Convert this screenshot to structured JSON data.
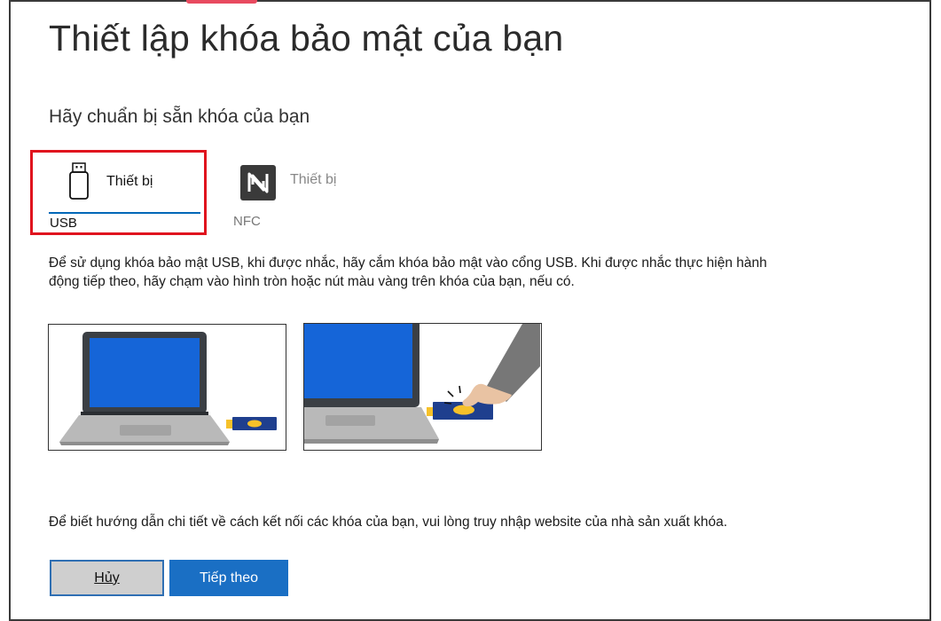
{
  "dialog": {
    "title": "Thiết lập khóa bảo mật của bạn",
    "subtitle": "Hãy chuẩn bị sẵn khóa của bạn"
  },
  "tabs": [
    {
      "label_line1": "Thiết bị",
      "label_line2": "USB",
      "icon": "usb-drive-icon",
      "selected": true
    },
    {
      "label_line1": "Thiết bị",
      "label_line2": "NFC",
      "icon": "nfc-icon",
      "selected": false
    }
  ],
  "instructions": "Để sử dụng khóa bảo mật USB, khi được nhắc, hãy cắm khóa bảo mật vào cổng USB. Khi được nhắc thực hiện hành động tiếp theo, hãy chạm vào hình tròn hoặc nút màu vàng trên khóa của bạn, nếu có.",
  "illustrations": [
    {
      "name": "laptop-with-usb-key-illustration"
    },
    {
      "name": "finger-touching-key-illustration"
    }
  ],
  "footer_note": "Để biết hướng dẫn chi tiết về cách kết nối các khóa của bạn, vui lòng truy nhập website của nhà sản xuất khóa.",
  "buttons": {
    "cancel": "Hủy",
    "next": "Tiếp theo"
  },
  "colors": {
    "selection_highlight": "#e0141e",
    "tab_underline": "#0067b8",
    "primary_button": "#1a6fc4",
    "screen_blue": "#1565d8",
    "key_yellow": "#f6c12a"
  }
}
